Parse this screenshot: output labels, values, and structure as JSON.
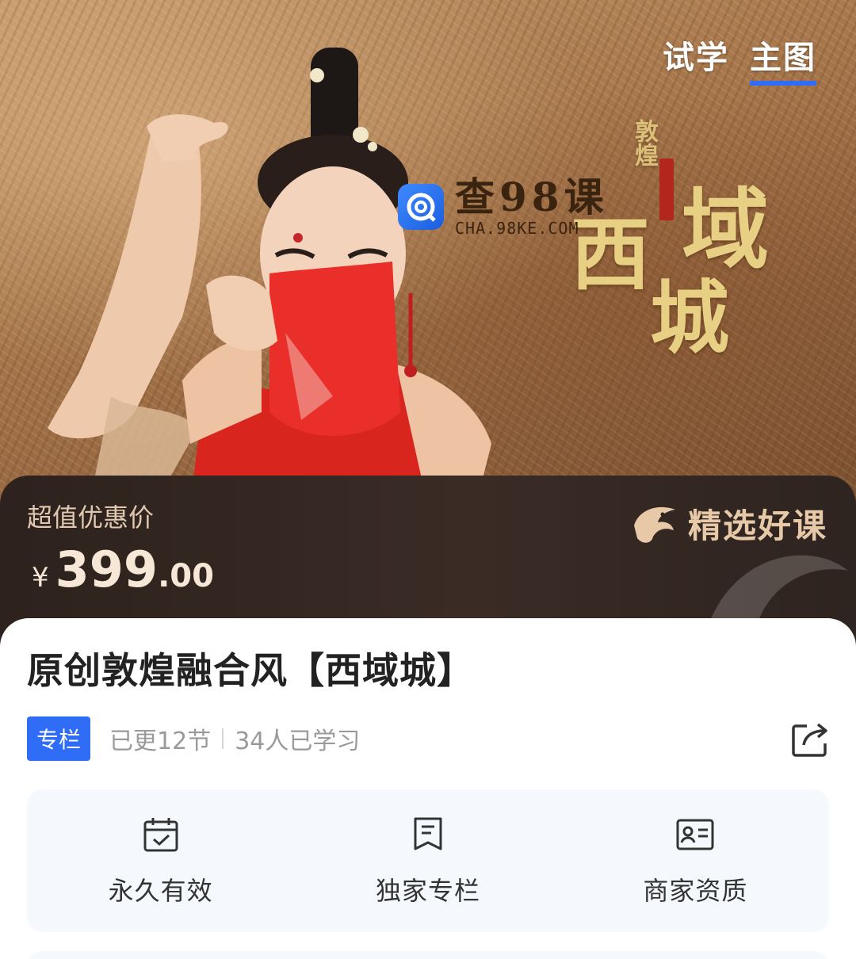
{
  "banner": {
    "tabs": [
      {
        "label": "试学",
        "active": false
      },
      {
        "label": "主图",
        "active": true
      }
    ],
    "watermark": {
      "title": "查98课",
      "subtitle": "CHA.98KE.COM"
    },
    "calligraphy": {
      "small": "敦煌",
      "large": [
        "西",
        "域",
        "城"
      ]
    }
  },
  "price": {
    "label": "超值优惠价",
    "currency": "¥",
    "integer": "399",
    "decimal": ".00",
    "badge": "精选好课"
  },
  "course": {
    "title": "原创敦煌融合风【西域城】",
    "tag": "专栏",
    "updated": "已更12节",
    "learners": "34人已学习"
  },
  "features": [
    {
      "icon": "calendar-check-icon",
      "label": "永久有效"
    },
    {
      "icon": "bookmark-note-icon",
      "label": "独家专栏"
    },
    {
      "icon": "id-card-icon",
      "label": "商家资质"
    }
  ],
  "colors": {
    "accent": "#2f6df6",
    "price_bg": "#2d221d",
    "price_text": "#f6e7d6",
    "calligraphy": "#e7cf84"
  }
}
